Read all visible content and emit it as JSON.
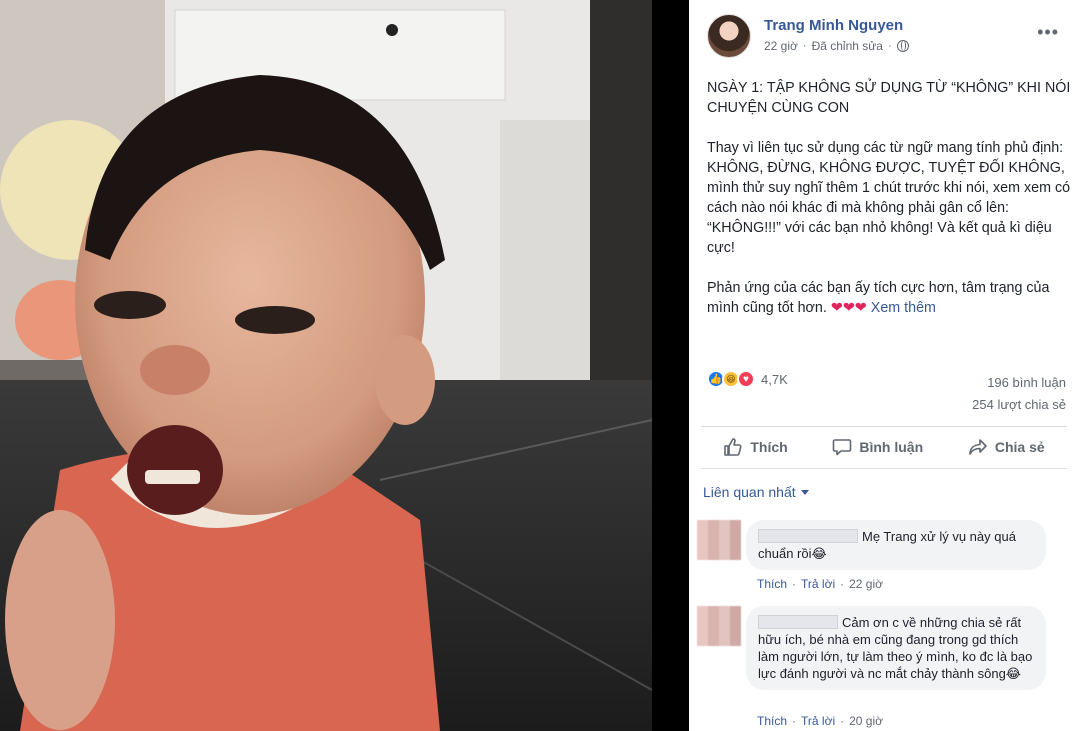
{
  "post": {
    "author": "Trang Minh Nguyen",
    "time": "22 giờ",
    "edited": "Đã chỉnh sửa",
    "privacy_icon": "globe-icon",
    "paragraphs": [
      "NGÀY 1: TẬP KHÔNG SỬ DỤNG TỪ “KHÔNG” KHI NÓI CHUYỆN CÙNG CON",
      "Thay vì liên tục sử dụng các từ ngữ mang tính phủ định: KHÔNG, ĐỪNG, KHÔNG ĐƯỢC, TUYỆT ĐỐI KHÔNG, mình thử suy nghĩ thêm 1 chút trước khi nói, xem xem có cách nào nói khác đi mà không phải gân cổ lên: “KHÔNG!!!” với các bạn nhỏ không! Và kết quả kì diệu cực!"
    ],
    "last_paragraph": "Phản ứng của các bạn ấy tích cực hơn, tâm trạng của mình cũng tốt hơn.",
    "hearts": "❤❤❤",
    "see_more": "Xem thêm"
  },
  "reactions": {
    "count": "4,7K",
    "types": [
      "like",
      "haha",
      "love"
    ]
  },
  "stats": {
    "comments": "196 bình luận",
    "shares": "254 lượt chia sẻ"
  },
  "actions": {
    "like": "Thích",
    "comment": "Bình luận",
    "share": "Chia sẻ"
  },
  "related_label": "Liên quan nhất",
  "comments": [
    {
      "text": "Mẹ Trang xử lý vụ này quá chuẩn rồi",
      "emoji": "😂",
      "like": "Thích",
      "reply": "Trả lời",
      "time": "22 giờ"
    },
    {
      "text": "Cảm ơn c về những chia sẻ rất hữu ích, bé nhà em cũng đang trong gd thích làm người lớn, tự làm theo ý mình, ko đc là bạo lực đánh người và nc mắt chảy thành sông",
      "emoji": "😂",
      "like": "Thích",
      "reply": "Trả lời",
      "time": "20 giờ"
    }
  ],
  "colors": {
    "link": "#385898",
    "secondary": "#606770",
    "like_blue": "#1877f2"
  }
}
